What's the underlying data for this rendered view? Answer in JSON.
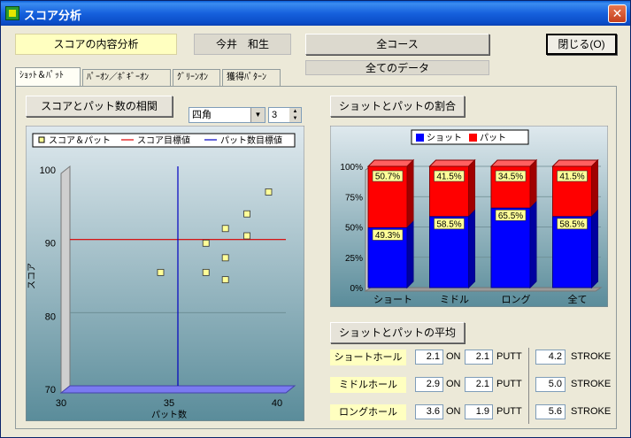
{
  "window": {
    "title": "スコア分析",
    "close_glyph": "✕"
  },
  "header": {
    "analysis_label": "スコアの内容分析",
    "player_name": "今井　和生",
    "course_button": "全コース",
    "data_label": "全てのデータ",
    "close_button": "閉じる(O)"
  },
  "tabs": [
    "ｼｮｯﾄ＆ﾊﾟｯﾄ",
    "ﾊﾟｰｵﾝ／ﾎﾞｷﾞｰｵﾝ",
    "ｸﾞﾘｰﾝｵﾝ",
    "獲得ﾊﾟﾀｰﾝ"
  ],
  "left_panel": {
    "button": "スコアとパット数の相関",
    "shape_select": "四角",
    "spin_value": "3"
  },
  "right_panel": {
    "ratio_button": "ショットとパットの割合",
    "average_button": "ショットとパットの平均"
  },
  "averages": {
    "rows": [
      {
        "label": "ショートホール",
        "on": "2.1",
        "on_label": "ON",
        "putt": "2.1",
        "putt_label": "PUTT",
        "stroke": "4.2",
        "stroke_label": "STROKE"
      },
      {
        "label": "ミドルホール",
        "on": "2.9",
        "on_label": "ON",
        "putt": "2.1",
        "putt_label": "PUTT",
        "stroke": "5.0",
        "stroke_label": "STROKE"
      },
      {
        "label": "ロングホール",
        "on": "3.6",
        "on_label": "ON",
        "putt": "1.9",
        "putt_label": "PUTT",
        "stroke": "5.6",
        "stroke_label": "STROKE"
      }
    ]
  },
  "colors": {
    "shot": "#0000ff",
    "putt": "#ff0000",
    "plot_bg_top": "#dfe9ee",
    "plot_bg_bottom": "#5a8c9a"
  },
  "chart_data": [
    {
      "type": "scatter",
      "title": "",
      "xlabel": "パット数",
      "ylabel": "スコア",
      "xlim": [
        30,
        40
      ],
      "ylim": [
        70,
        100
      ],
      "xticks": [
        30,
        35,
        40
      ],
      "yticks": [
        70,
        80,
        90,
        100
      ],
      "legend": [
        "スコア＆パット",
        "スコア目標値",
        "パット数目標値"
      ],
      "points": [
        {
          "x": 34.2,
          "y": 85.5
        },
        {
          "x": 36.3,
          "y": 89.5
        },
        {
          "x": 36.3,
          "y": 85.5
        },
        {
          "x": 37.2,
          "y": 91.5
        },
        {
          "x": 37.2,
          "y": 87.5
        },
        {
          "x": 37.2,
          "y": 84.5
        },
        {
          "x": 38.2,
          "y": 93.5
        },
        {
          "x": 38.2,
          "y": 90.5
        },
        {
          "x": 39.2,
          "y": 96.5
        }
      ],
      "score_target": 90,
      "putt_target": 35
    },
    {
      "type": "bar",
      "stacked": true,
      "categories": [
        "ショート",
        "ミドル",
        "ロング",
        "全て"
      ],
      "yticks": [
        "0%",
        "25%",
        "50%",
        "75%",
        "100%"
      ],
      "series": [
        {
          "name": "ショット",
          "values": [
            49.3,
            58.5,
            65.5,
            58.5
          ],
          "labels": [
            "49.3%",
            "58.5%",
            "65.5%",
            "58.5%"
          ]
        },
        {
          "name": "パット",
          "values": [
            50.7,
            41.5,
            34.5,
            41.5
          ],
          "labels": [
            "50.7%",
            "41.5%",
            "34.5%",
            "41.5%"
          ]
        }
      ]
    }
  ]
}
